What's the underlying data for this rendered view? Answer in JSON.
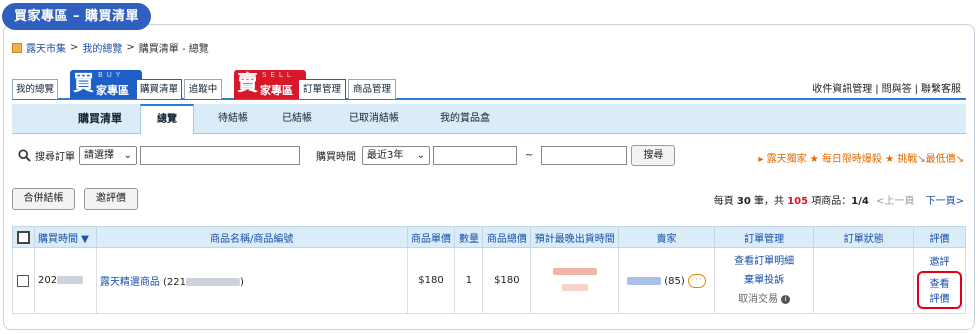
{
  "header": {
    "title": "買家專區 – 購買清單"
  },
  "breadcrumb": {
    "items": [
      "露天市集",
      "我的總覽",
      "購買清單 - 總覽"
    ],
    "sep": ">"
  },
  "top_tabs": {
    "my_overview": "我的總覽",
    "buy_big": "買",
    "buy_eng": "BUY",
    "buy_small": "家專區",
    "buy_list": "購買清單",
    "tracking": "追蹤中",
    "sell_big": "賣",
    "sell_eng": "SELL",
    "sell_small": "家專區",
    "order_mgmt": "訂單管理",
    "product_mgmt": "商品管理",
    "links": [
      "收件資訊管理",
      "問與答",
      "聯繫客服"
    ]
  },
  "sub_tabs": {
    "title": "購買清單",
    "items": [
      "總覽",
      "待結帳",
      "已結帳",
      "已取消結帳",
      "我的賞品盒"
    ],
    "active": "總覽"
  },
  "search": {
    "order_label": "搜尋訂單",
    "order_select": "請選擇",
    "time_label": "購買時間",
    "time_select": "最近3年",
    "tilde": "~",
    "button": "搜尋"
  },
  "promo": "▸ 露天獨家 ★ 每日限時爆殺 ★ 挑戰↘最低價↘",
  "actions": {
    "merge_checkout": "合併結帳",
    "rate": "邀評價"
  },
  "pager": {
    "per_page_prefix": "每頁",
    "per_page": "30",
    "per_page_suffix": "筆，共",
    "total": "105",
    "total_suffix": "項商品：",
    "page": "1/4",
    "prev": "<上一頁",
    "next": "下一頁>"
  },
  "table": {
    "headers": [
      "購買時間 ▼",
      "商品名稱/商品編號",
      "商品單價",
      "數量",
      "商品總價",
      "預計最晚出貨時間",
      "賣家",
      "訂單管理",
      "訂單狀態",
      "評價"
    ],
    "row": {
      "time": "202",
      "product": "露天精選商品",
      "product_code": "(221",
      "product_code_end": ")",
      "unit_price": "$180",
      "qty": "1",
      "total": "$180",
      "seller_score": "(85)",
      "order_detail": "查看訂單明細",
      "abandon": "棄單投訴",
      "cancel": "取消交易",
      "rate_short": "邀評",
      "view_rating": "查看評價"
    }
  },
  "colors": {
    "accent": "#2c7fd0",
    "buy": "#1d5fc4",
    "sell": "#d8172a",
    "promo": "#e06a00",
    "highlight": "#e0001a"
  }
}
